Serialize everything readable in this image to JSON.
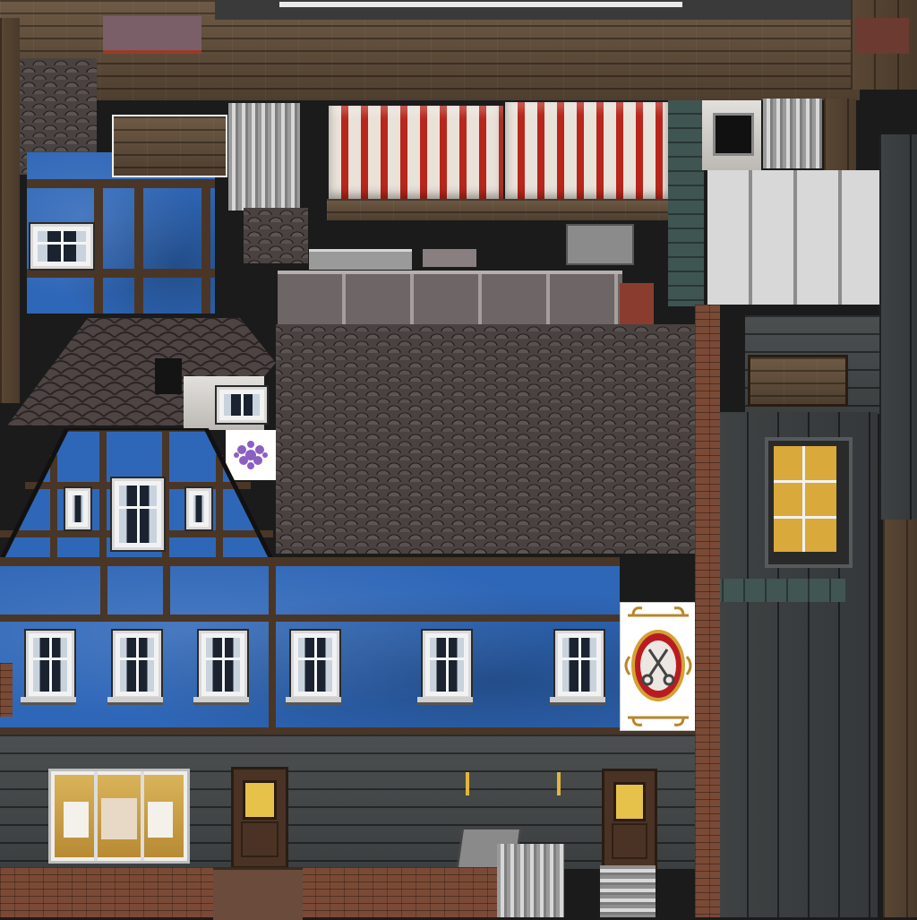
{
  "texture": {
    "title": "",
    "kind": "building facade texture atlas"
  },
  "colors": {
    "blue_wall": "#2f67b8",
    "awning_red": "#b8261c",
    "awning_white": "#e9e2d9",
    "timber": "#4a3626",
    "slate": "#3f4344",
    "shop_glow": "#e7c24a",
    "sign_red": "#b81c22"
  },
  "sign": {
    "icon": "scissors-icon",
    "shape": "oval emblem"
  },
  "icons": {
    "hairdresser_sign": "scissors-icon",
    "flower_patch": "lavender-flower-icon"
  },
  "regions": [
    "top-wood-beams",
    "upper-left-half-timbered-wall",
    "striped-awnings",
    "corrugated-metal-panels",
    "large-shingle-roof",
    "small-gable-roof",
    "blue-half-timber-gable",
    "blue-main-facade",
    "slate-ground-floor",
    "right-slate-tower",
    "brick-strips",
    "hairdresser-sign"
  ]
}
